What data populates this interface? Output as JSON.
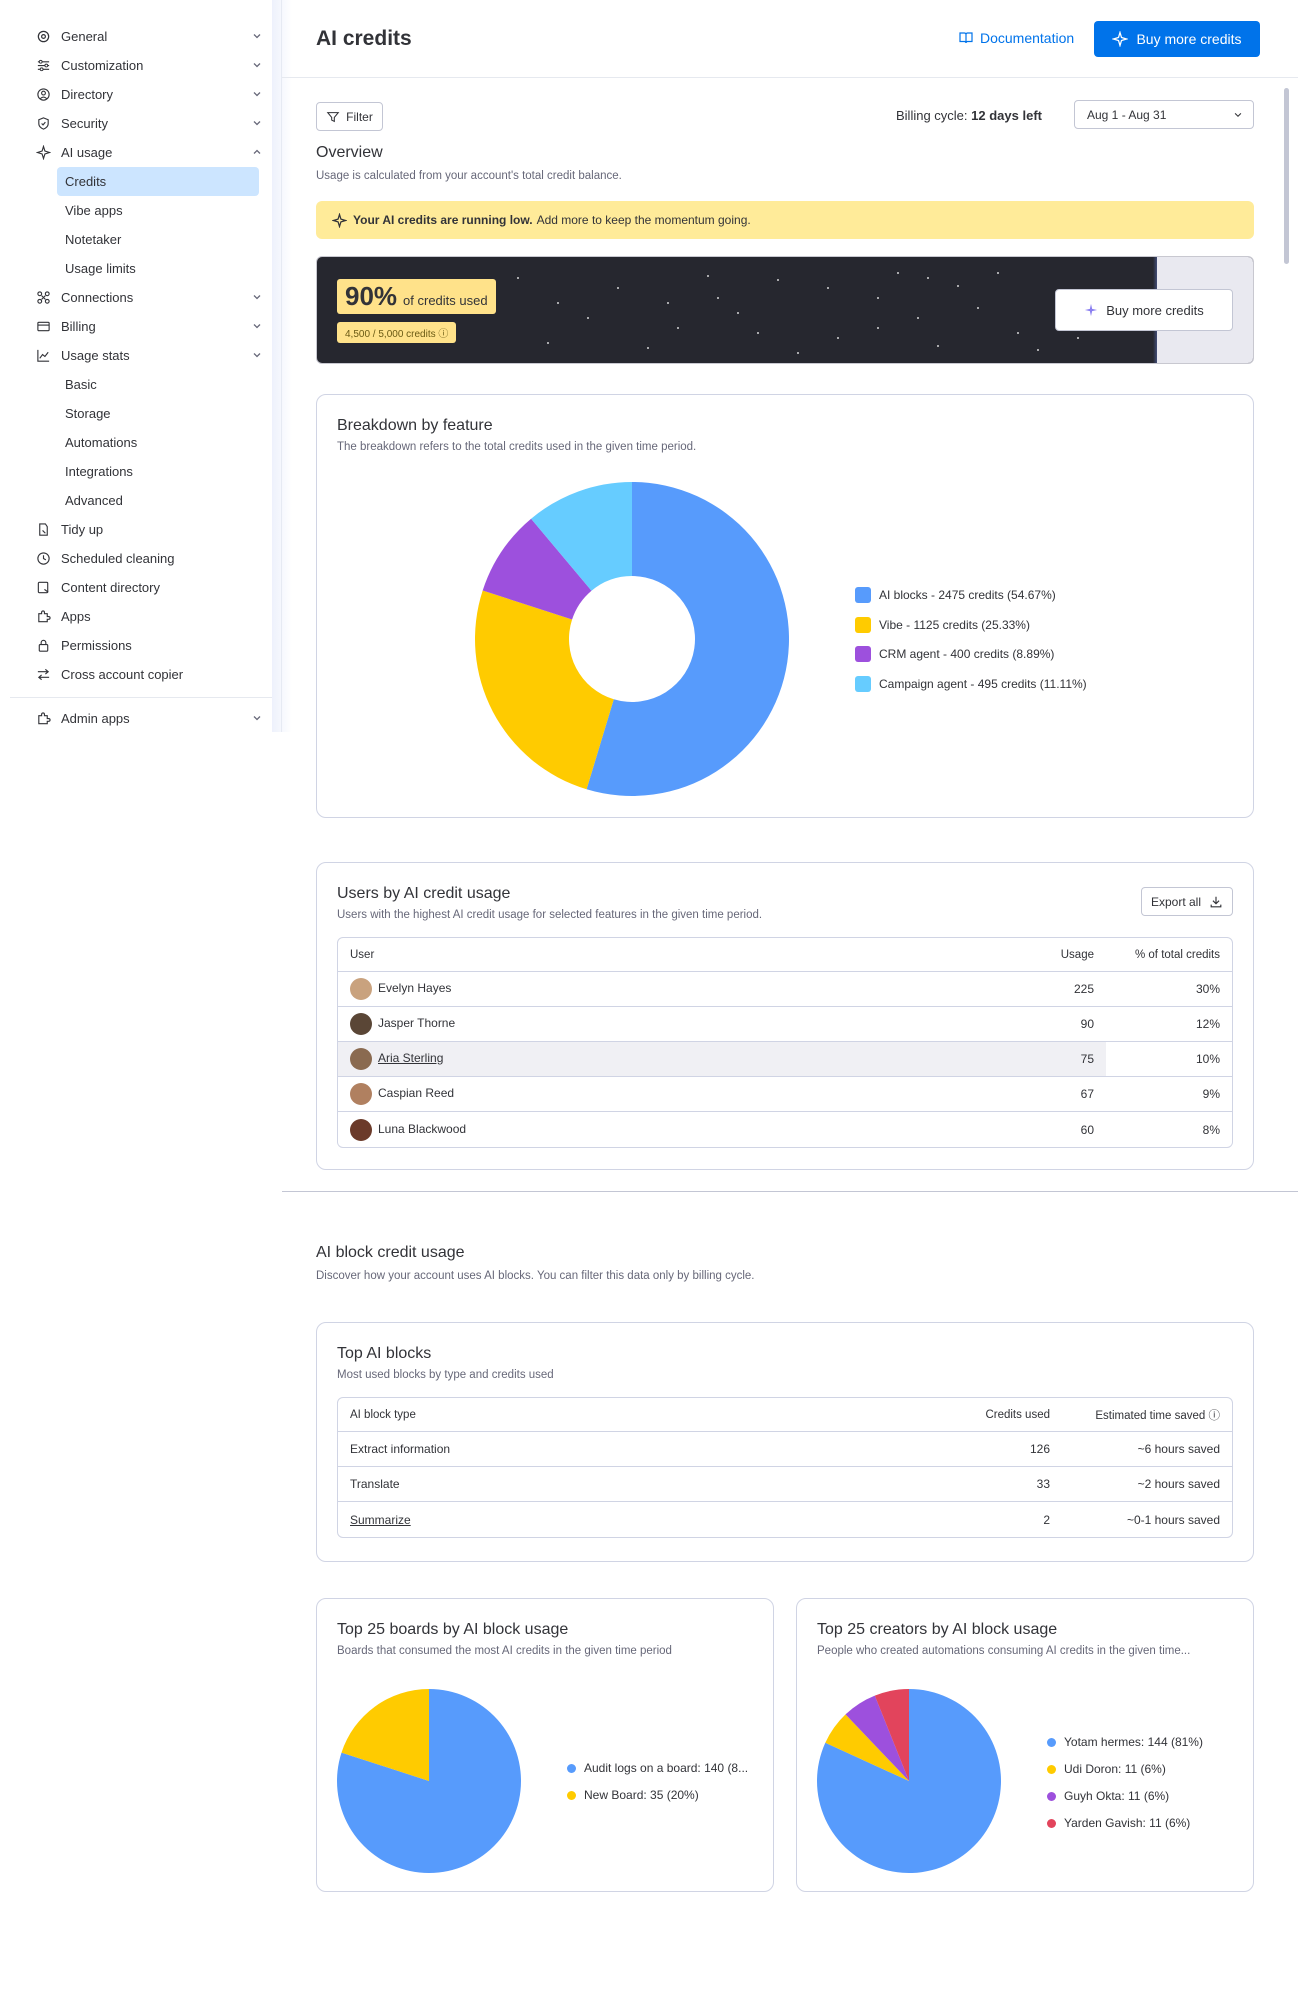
{
  "sidebar": {
    "items": [
      {
        "label": "General",
        "icon": "gear-icon",
        "chevron": "down"
      },
      {
        "label": "Customization",
        "icon": "sliders-icon",
        "chevron": "down"
      },
      {
        "label": "Directory",
        "icon": "user-circle-icon",
        "chevron": "down"
      },
      {
        "label": "Security",
        "icon": "shield-icon",
        "chevron": "down"
      },
      {
        "label": "AI usage",
        "icon": "sparkle-icon",
        "chevron": "up"
      }
    ],
    "ai_usage_sub": [
      "Credits",
      "Vibe apps",
      "Notetaker",
      "Usage limits"
    ],
    "items2": [
      {
        "label": "Connections",
        "icon": "connections-icon",
        "chevron": "down"
      },
      {
        "label": "Billing",
        "icon": "card-icon",
        "chevron": "down"
      },
      {
        "label": "Usage stats",
        "icon": "chart-line-icon",
        "chevron": "down"
      }
    ],
    "usage_stats_sub": [
      "Basic",
      "Storage",
      "Automations",
      "Integrations",
      "Advanced"
    ],
    "items3": [
      {
        "label": "Tidy up",
        "icon": "broom-icon"
      },
      {
        "label": "Scheduled cleaning",
        "icon": "clock-icon"
      },
      {
        "label": "Content directory",
        "icon": "folder-icon"
      },
      {
        "label": "Apps",
        "icon": "puzzle-icon"
      },
      {
        "label": "Permissions",
        "icon": "lock-icon"
      },
      {
        "label": "Cross account copier",
        "icon": "arrows-icon"
      }
    ],
    "admin_apps": "Admin apps"
  },
  "header": {
    "title": "AI credits",
    "documentation": "Documentation",
    "buy_more": "Buy more credits"
  },
  "toolbar": {
    "filter": "Filter",
    "billing_label": "Billing cycle:",
    "billing_value": "12 days left",
    "date_range": "Aug 1 - Aug 31"
  },
  "overview": {
    "title": "Overview",
    "desc": "Usage is calculated from your account's total credit balance.",
    "alert_bold": "Your AI credits are running low.",
    "alert_text": "Add more to keep the momentum going.",
    "percent": "90%",
    "percent_label": "of credits used",
    "credits": "4,500 / 5,000 credits",
    "progress_fraction": 0.9,
    "banner_button": "Buy more credits"
  },
  "breakdown": {
    "title": "Breakdown by feature",
    "desc": "The breakdown refers to the total credits used in the given time period."
  },
  "users": {
    "title": "Users by AI credit usage",
    "desc": "Users with the highest AI credit usage for selected features in the given time period.",
    "export": "Export all",
    "columns": [
      "User",
      "Usage",
      "% of total credits"
    ],
    "rows": [
      {
        "name": "Evelyn Hayes",
        "usage": "225",
        "pct": "30%",
        "color": "#c9a27e"
      },
      {
        "name": "Jasper Thorne",
        "usage": "90",
        "pct": "12%",
        "color": "#5a4636"
      },
      {
        "name": "Aria Sterling",
        "usage": "75",
        "pct": "10%",
        "color": "#8a6a50"
      },
      {
        "name": "Caspian Reed",
        "usage": "67",
        "pct": "9%",
        "color": "#b08060"
      },
      {
        "name": "Luna Blackwood",
        "usage": "60",
        "pct": "8%",
        "color": "#6b3a2a"
      }
    ]
  },
  "ai_blocks": {
    "section_title": "AI block credit usage",
    "section_desc": "Discover how your account uses AI blocks. You can filter this data only by billing cycle.",
    "top_title": "Top AI blocks",
    "top_desc": "Most used blocks by type and credits used",
    "columns": [
      "AI block type",
      "Credits used",
      "Estimated time saved"
    ],
    "rows": [
      {
        "type": "Extract information",
        "credits": "126",
        "saved": "~6 hours saved"
      },
      {
        "type": "Translate",
        "credits": "33",
        "saved": "~2 hours saved"
      },
      {
        "type": "Summarize",
        "credits": "2",
        "saved": "~0-1 hours saved"
      }
    ]
  },
  "boards": {
    "title": "Top 25 boards by AI block usage",
    "desc": "Boards that consumed the most AI credits in the given time period"
  },
  "creators": {
    "title": "Top 25 creators by AI block usage",
    "desc": "People who created automations consuming AI credits in the given time..."
  },
  "chart_data": [
    {
      "type": "pie",
      "donut": true,
      "title": "Breakdown by feature",
      "slices": [
        {
          "label": "AI blocks - 2475 credits (54.67%)",
          "value": 54.67,
          "color": "#579bfc"
        },
        {
          "label": "Vibe - 1125 credits (25.33%)",
          "value": 25.33,
          "color": "#ffcb00"
        },
        {
          "label": "CRM agent - 400 credits (8.89%)",
          "value": 8.89,
          "color": "#9d50dd"
        },
        {
          "label": "Campaign agent - 495 credits (11.11%)",
          "value": 11.11,
          "color": "#66ccff"
        }
      ]
    },
    {
      "type": "pie",
      "donut": false,
      "title": "Top 25 boards by AI block usage",
      "slices": [
        {
          "label": "Audit logs on a board: 140 (8...",
          "value": 80,
          "color": "#579bfc"
        },
        {
          "label": "New Board: 35 (20%)",
          "value": 20,
          "color": "#ffcb00"
        }
      ]
    },
    {
      "type": "pie",
      "donut": false,
      "title": "Top 25 creators by AI block usage",
      "slices": [
        {
          "label": "Yotam hermes: 144 (81%)",
          "value": 81,
          "color": "#579bfc"
        },
        {
          "label": "Udi Doron: 11 (6%)",
          "value": 6,
          "color": "#ffcb00"
        },
        {
          "label": "Guyh Okta: 11 (6%)",
          "value": 6,
          "color": "#9d50dd"
        },
        {
          "label": "Yarden Gavish: 11 (6%)",
          "value": 6,
          "color": "#e2445c"
        }
      ]
    }
  ]
}
